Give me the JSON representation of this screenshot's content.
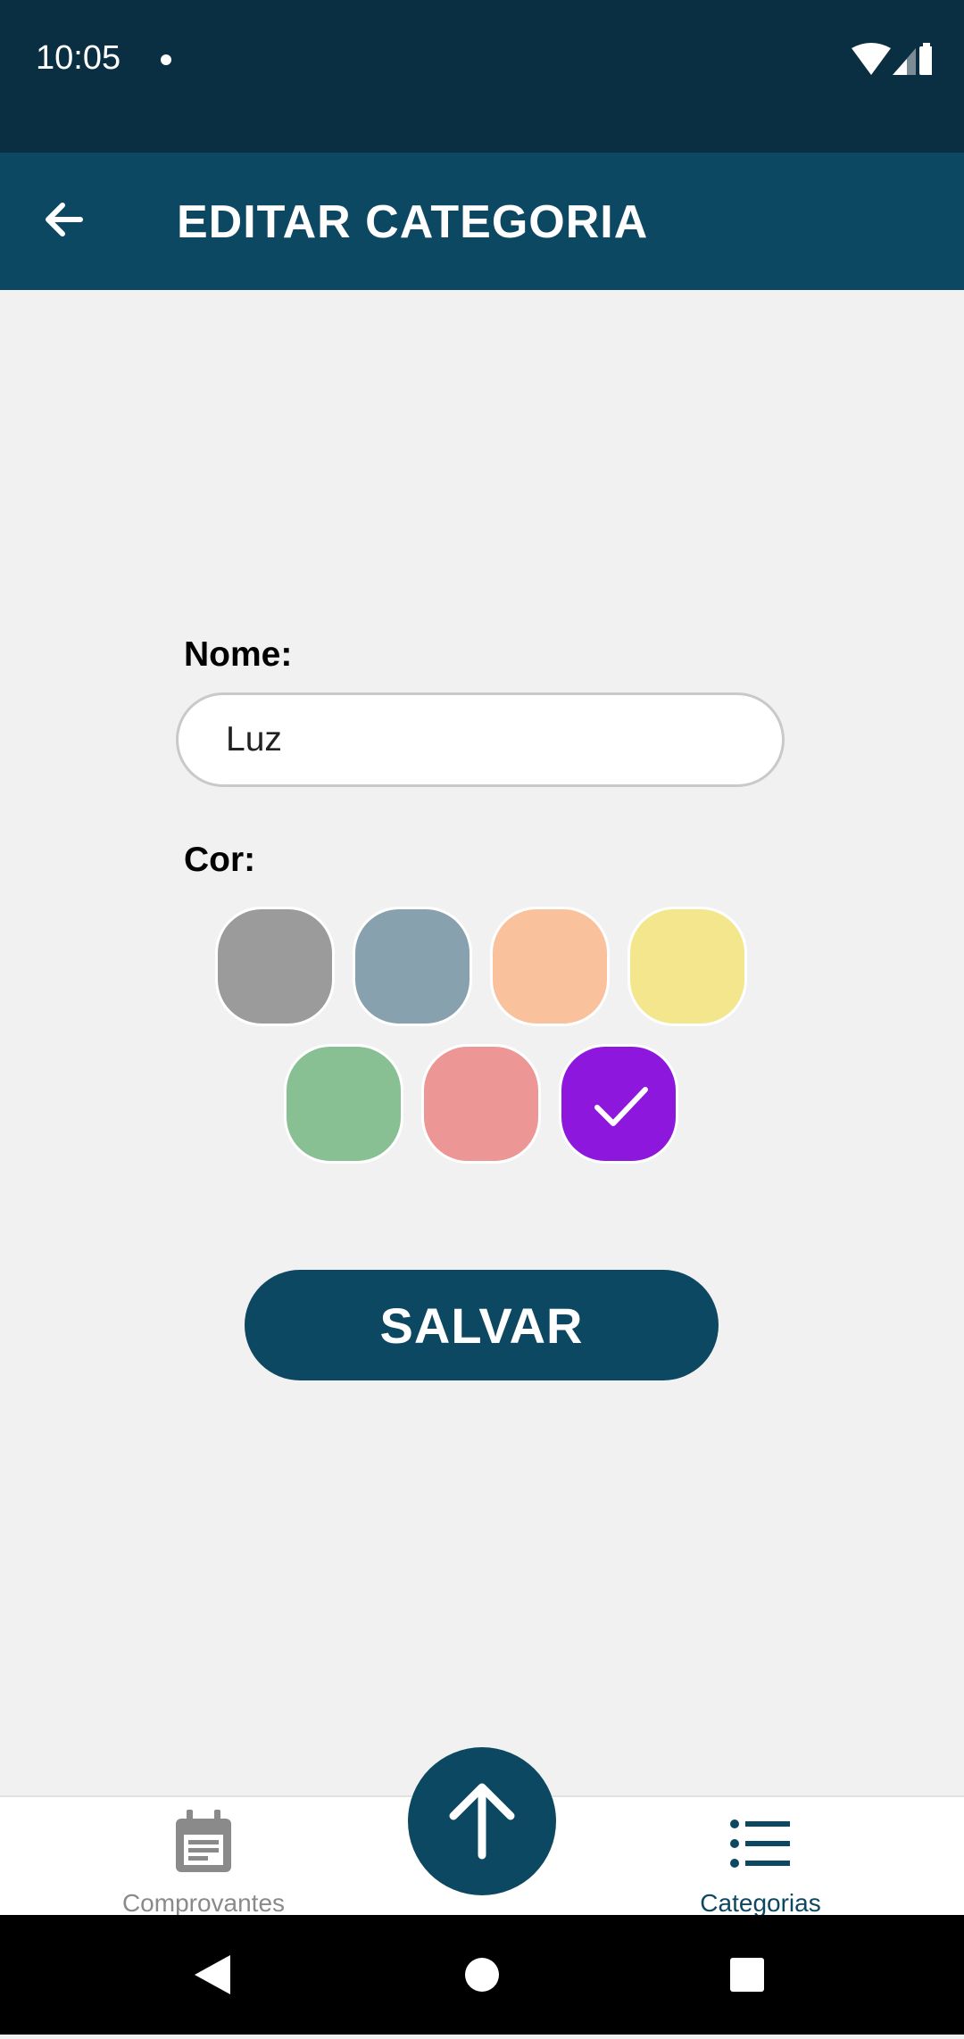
{
  "status_bar": {
    "time": "10:05",
    "icons": [
      "wifi-icon",
      "cell-signal-icon",
      "battery-icon"
    ]
  },
  "app_bar": {
    "title": "EDITAR CATEGORIA",
    "back_icon": "arrow-back-icon"
  },
  "form": {
    "name_label": "Nome:",
    "name_value": "Luz",
    "color_label": "Cor:",
    "colors": [
      {
        "hex": "#9b9b9b",
        "selected": false
      },
      {
        "hex": "#87a2ae",
        "selected": false
      },
      {
        "hex": "#f9c29d",
        "selected": false
      },
      {
        "hex": "#f3e68c",
        "selected": false
      },
      {
        "hex": "#88c093",
        "selected": false
      },
      {
        "hex": "#ec9695",
        "selected": false
      },
      {
        "hex": "#8e17de",
        "selected": true
      }
    ],
    "save_label": "SALVAR"
  },
  "bottom_nav": {
    "items": [
      {
        "label": "Comprovantes",
        "icon": "receipt-calendar-icon",
        "active": false
      },
      {
        "label": "Categorias",
        "icon": "list-icon",
        "active": true
      }
    ],
    "fab_icon": "arrow-up-icon"
  },
  "system_nav": {
    "icons": [
      "back-triangle-icon",
      "home-circle-icon",
      "recents-square-icon"
    ]
  },
  "colors": {
    "primary": "#0d4862",
    "status_bar": "#0a2f42",
    "background": "#f1f1f1",
    "nav_inactive": "#8a8a8a"
  }
}
